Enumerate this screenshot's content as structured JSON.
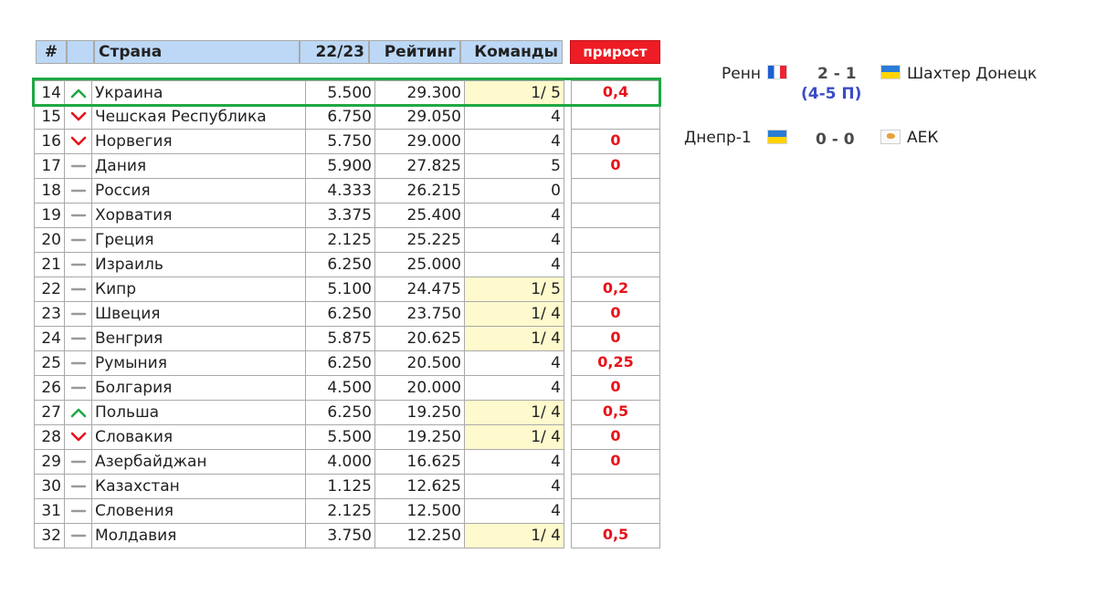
{
  "table": {
    "headers": {
      "num": "#",
      "trend": "",
      "country": "Страна",
      "season": "22/23",
      "rating": "Рейтинг",
      "teams": "Команды",
      "growth": "прирост"
    },
    "rows": [
      {
        "num": "14",
        "trend": "up",
        "country": "Украина",
        "season": "5.500",
        "rating": "29.300",
        "teams": "1/ 5",
        "teams_highlight": true,
        "growth": "0,4"
      },
      {
        "num": "15",
        "trend": "down",
        "country": "Чешская Республика",
        "season": "6.750",
        "rating": "29.050",
        "teams": "4",
        "teams_highlight": false,
        "growth": ""
      },
      {
        "num": "16",
        "trend": "down",
        "country": "Норвегия",
        "season": "5.750",
        "rating": "29.000",
        "teams": "4",
        "teams_highlight": false,
        "growth": "0"
      },
      {
        "num": "17",
        "trend": "same",
        "country": "Дания",
        "season": "5.900",
        "rating": "27.825",
        "teams": "5",
        "teams_highlight": false,
        "growth": "0"
      },
      {
        "num": "18",
        "trend": "same",
        "country": "Россия",
        "season": "4.333",
        "rating": "26.215",
        "teams": "0",
        "teams_highlight": false,
        "growth": ""
      },
      {
        "num": "19",
        "trend": "same",
        "country": "Хорватия",
        "season": "3.375",
        "rating": "25.400",
        "teams": "4",
        "teams_highlight": false,
        "growth": ""
      },
      {
        "num": "20",
        "trend": "same",
        "country": "Греция",
        "season": "2.125",
        "rating": "25.225",
        "teams": "4",
        "teams_highlight": false,
        "growth": ""
      },
      {
        "num": "21",
        "trend": "same",
        "country": "Израиль",
        "season": "6.250",
        "rating": "25.000",
        "teams": "4",
        "teams_highlight": false,
        "growth": ""
      },
      {
        "num": "22",
        "trend": "same",
        "country": "Кипр",
        "season": "5.100",
        "rating": "24.475",
        "teams": "1/ 5",
        "teams_highlight": true,
        "growth": "0,2"
      },
      {
        "num": "23",
        "trend": "same",
        "country": "Швеция",
        "season": "6.250",
        "rating": "23.750",
        "teams": "1/ 4",
        "teams_highlight": true,
        "growth": "0"
      },
      {
        "num": "24",
        "trend": "same",
        "country": "Венгрия",
        "season": "5.875",
        "rating": "20.625",
        "teams": "1/ 4",
        "teams_highlight": true,
        "growth": "0"
      },
      {
        "num": "25",
        "trend": "same",
        "country": "Румыния",
        "season": "6.250",
        "rating": "20.500",
        "teams": "4",
        "teams_highlight": false,
        "growth": "0,25"
      },
      {
        "num": "26",
        "trend": "same",
        "country": "Болгария",
        "season": "4.500",
        "rating": "20.000",
        "teams": "4",
        "teams_highlight": false,
        "growth": "0"
      },
      {
        "num": "27",
        "trend": "up",
        "country": "Польша",
        "season": "6.250",
        "rating": "19.250",
        "teams": "1/ 4",
        "teams_highlight": true,
        "growth": "0,5"
      },
      {
        "num": "28",
        "trend": "down",
        "country": "Словакия",
        "season": "5.500",
        "rating": "19.250",
        "teams": "1/ 4",
        "teams_highlight": true,
        "growth": "0"
      },
      {
        "num": "29",
        "trend": "same",
        "country": "Азербайджан",
        "season": "4.000",
        "rating": "16.625",
        "teams": "4",
        "teams_highlight": false,
        "growth": "0"
      },
      {
        "num": "30",
        "trend": "same",
        "country": "Казахстан",
        "season": "1.125",
        "rating": "12.625",
        "teams": "4",
        "teams_highlight": false,
        "growth": ""
      },
      {
        "num": "31",
        "trend": "same",
        "country": "Словения",
        "season": "2.125",
        "rating": "12.500",
        "teams": "4",
        "teams_highlight": false,
        "growth": ""
      },
      {
        "num": "32",
        "trend": "same",
        "country": "Молдавия",
        "season": "3.750",
        "rating": "12.250",
        "teams": "1/ 4",
        "teams_highlight": true,
        "growth": "0,5"
      }
    ]
  },
  "matches": [
    {
      "home": "Ренн",
      "home_flag": "france-flag",
      "score": "2 - 1",
      "note": "(4-5 П)",
      "away": "Шахтер Донецк",
      "away_flag": "ukraine-flag"
    },
    {
      "home": "Днепр-1",
      "home_flag": "ukraine-flag",
      "score": "0 - 0",
      "note": "",
      "away": "АЕК",
      "away_flag": "cyprus-flag"
    }
  ],
  "colors": {
    "header_bg": "#bcd8f6",
    "growth_header_bg": "#ee1c24",
    "growth_text": "#e8121a",
    "teams_highlight_bg": "#fffacd",
    "frame": "#1fa843",
    "trend_up": "#1fa843",
    "trend_down": "#e8121a",
    "trend_same": "#9a9a9a"
  }
}
